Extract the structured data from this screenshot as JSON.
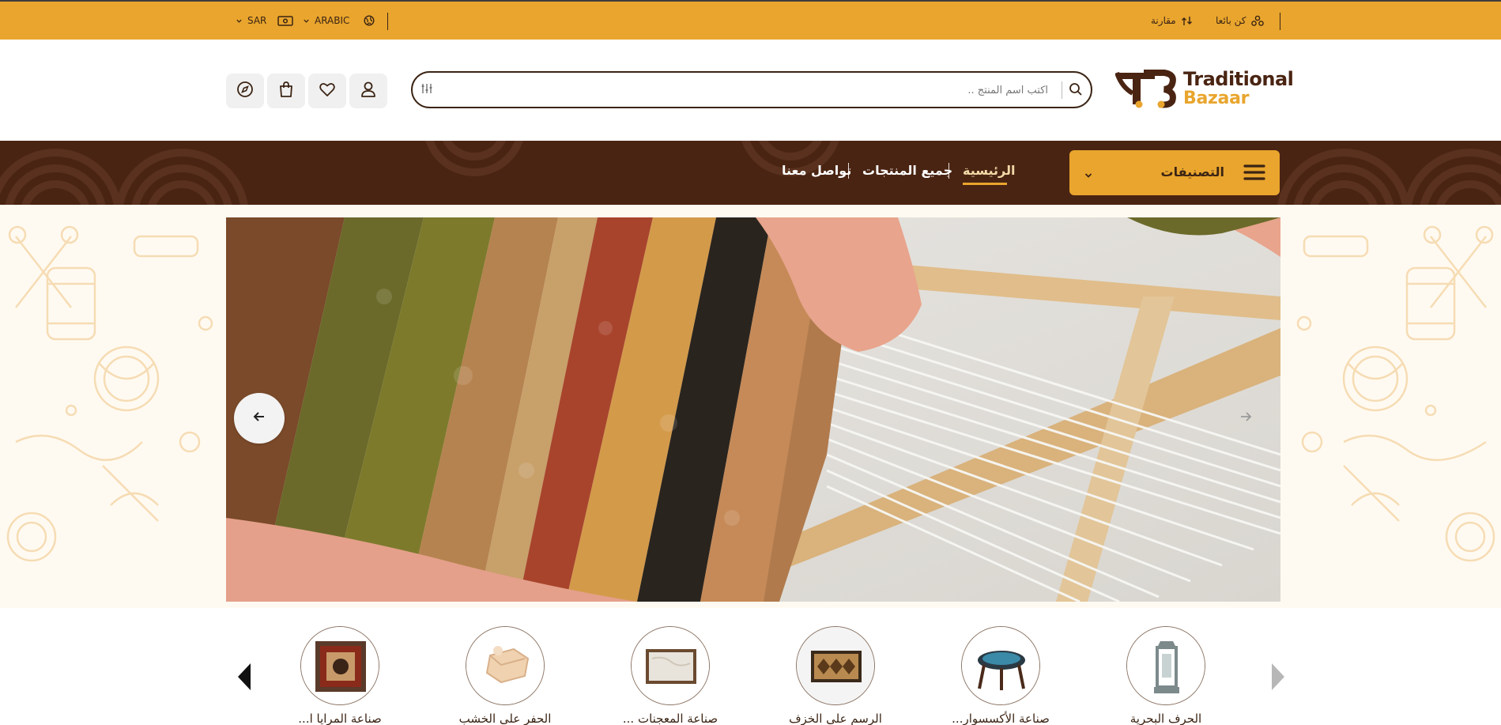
{
  "topbar": {
    "currency": "SAR",
    "language": "ARABIC",
    "be_seller": "كن بائعا",
    "compare": "مقارنة"
  },
  "logo": {
    "line1": "Traditional",
    "line2": "Bazaar"
  },
  "search": {
    "placeholder": "اكتب اسم المنتج .."
  },
  "nav": {
    "categories_label": "التصنيفات",
    "links": [
      "الرئيسية",
      "جميع المنتجات",
      "تواصل معنا"
    ],
    "active_index": 0
  },
  "categories": [
    {
      "name": "الحرف البحرية"
    },
    {
      "name": "صناعة الأكسسوار..."
    },
    {
      "name": "الرسم على الخزف"
    },
    {
      "name": "صناعة المعجنات ..."
    },
    {
      "name": "الحفر على الخشب"
    },
    {
      "name": "صناعة المرايا ا..."
    }
  ],
  "colors": {
    "brand_gold": "#e9a52d",
    "brand_brown": "#4a2412"
  }
}
